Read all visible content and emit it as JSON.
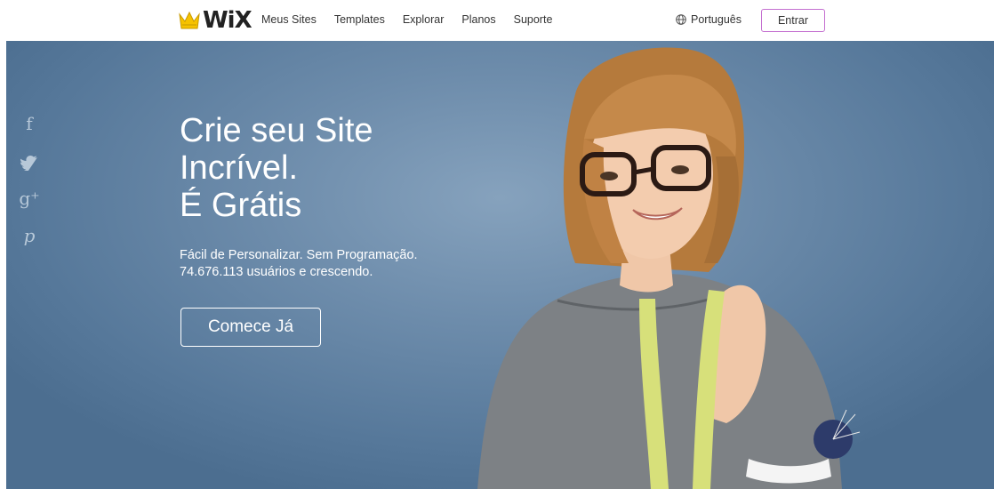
{
  "header": {
    "logo_text": "WiX",
    "nav": [
      "Meus Sites",
      "Templates",
      "Explorar",
      "Planos",
      "Suporte"
    ],
    "language": "Português",
    "login_label": "Entrar"
  },
  "hero": {
    "headline": [
      "Crie seu Site",
      "Incrível.",
      "É Grátis"
    ],
    "subline1": "Fácil de Personalizar. Sem Programação.",
    "subline2": "74.676.113 usuários e crescendo.",
    "cta_label": "Comece Já",
    "social_icons": [
      "facebook-icon",
      "twitter-icon",
      "google-plus-icon",
      "pinterest-icon"
    ],
    "social_glyphs": [
      "f",
      "🐦",
      "g⁺",
      "𝓅"
    ]
  },
  "colors": {
    "accent": "#c46fd0",
    "hero_bg": "#6d8cab"
  }
}
